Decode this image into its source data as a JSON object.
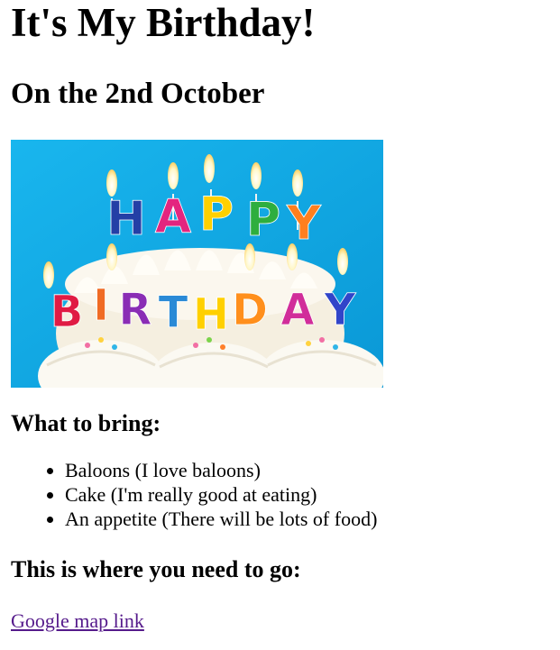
{
  "page": {
    "title": "It's My Birthday!",
    "subtitle": "On the 2nd October",
    "bring_heading": "What to bring:",
    "bring_items": [
      "Baloons (I love baloons)",
      "Cake (I'm really good at eating)",
      "An appetite (There will be lots of food)"
    ],
    "go_heading": "This is where you need to go:",
    "map_link_label": "Google map link"
  },
  "image": {
    "description_icon": "birthday-cake-candles-image",
    "candle_letters_top": [
      "H",
      "A",
      "P",
      "P",
      "Y"
    ],
    "candle_letters_bottom": [
      "B",
      "I",
      "R",
      "T",
      "H",
      "D",
      "A",
      "Y"
    ]
  },
  "colors": {
    "link_visited": "#551a8b",
    "image_background": "#11a6e0"
  }
}
